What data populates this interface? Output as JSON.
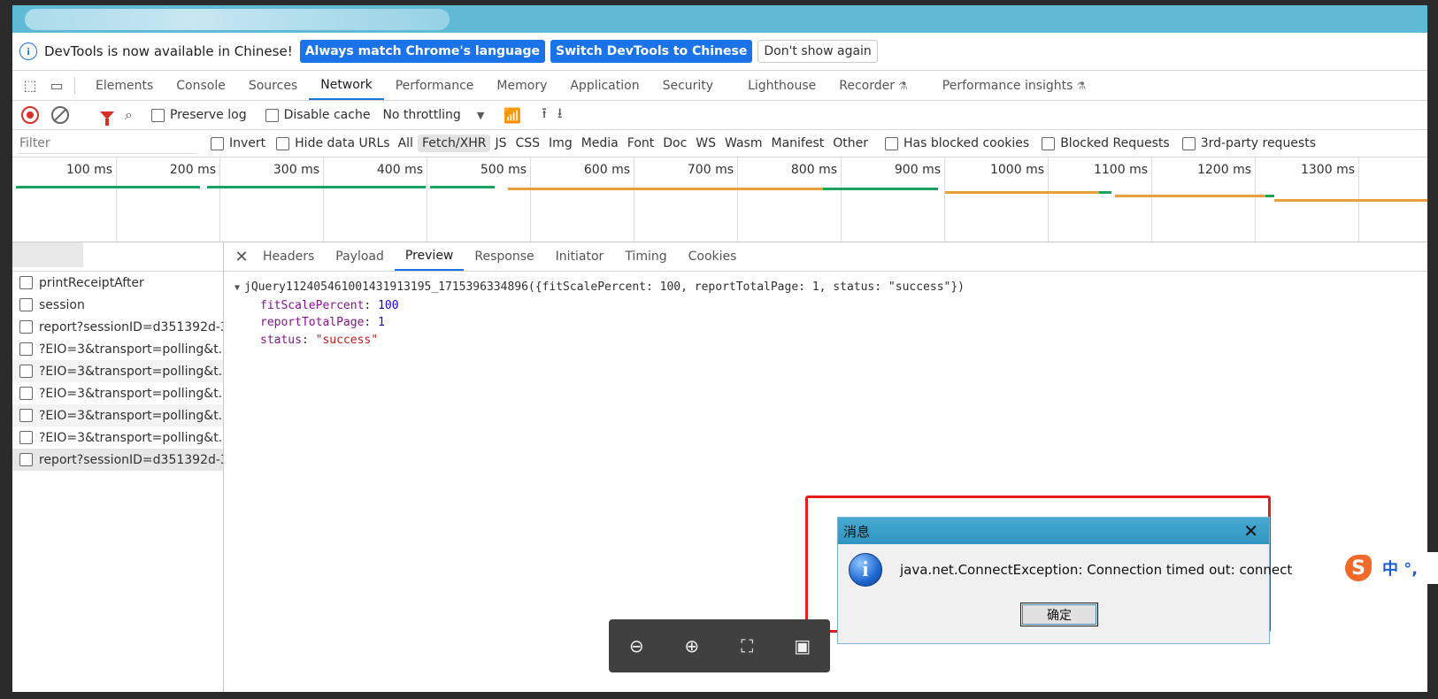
{
  "infobar": {
    "message": "DevTools is now available in Chinese!",
    "btn_match": "Always match Chrome's language",
    "btn_switch": "Switch DevTools to Chinese",
    "btn_dismiss": "Don't show again"
  },
  "tabs": [
    {
      "label": "Elements"
    },
    {
      "label": "Console"
    },
    {
      "label": "Sources"
    },
    {
      "label": "Network",
      "active": true
    },
    {
      "label": "Performance"
    },
    {
      "label": "Memory"
    },
    {
      "label": "Application"
    },
    {
      "label": "Security"
    },
    {
      "label": "Lighthouse"
    },
    {
      "label": "Recorder",
      "flask": true
    },
    {
      "label": "Performance insights",
      "flask": true
    }
  ],
  "toolbar": {
    "preserve_log": "Preserve log",
    "disable_cache": "Disable cache",
    "throttling": "No throttling"
  },
  "filterbar": {
    "placeholder": "Filter",
    "invert": "Invert",
    "hide_data_urls": "Hide data URLs",
    "types": [
      "All",
      "Fetch/XHR",
      "JS",
      "CSS",
      "Img",
      "Media",
      "Font",
      "Doc",
      "WS",
      "Wasm",
      "Manifest",
      "Other"
    ],
    "selected_type": "Fetch/XHR",
    "has_blocked_cookies": "Has blocked cookies",
    "blocked_requests": "Blocked Requests",
    "third_party": "3rd-party requests"
  },
  "timeline": {
    "ticks": [
      "100 ms",
      "200 ms",
      "300 ms",
      "400 ms",
      "500 ms",
      "600 ms",
      "700 ms",
      "800 ms",
      "900 ms",
      "1000 ms",
      "1100 ms",
      "1200 ms",
      "1300 ms"
    ]
  },
  "requests": [
    {
      "name": "printReceiptAfter"
    },
    {
      "name": "session"
    },
    {
      "name": "report?sessionID=d351392d-3..."
    },
    {
      "name": "?EIO=3&transport=polling&t..."
    },
    {
      "name": "?EIO=3&transport=polling&t..."
    },
    {
      "name": "?EIO=3&transport=polling&t..."
    },
    {
      "name": "?EIO=3&transport=polling&t..."
    },
    {
      "name": "?EIO=3&transport=polling&t..."
    },
    {
      "name": "report?sessionID=d351392d-3...",
      "selected": true
    }
  ],
  "detail_tabs": [
    {
      "label": "Headers"
    },
    {
      "label": "Payload"
    },
    {
      "label": "Preview",
      "active": true
    },
    {
      "label": "Response"
    },
    {
      "label": "Initiator"
    },
    {
      "label": "Timing"
    },
    {
      "label": "Cookies"
    }
  ],
  "preview": {
    "summary": "jQuery112405461001431913195_1715396334896({fitScalePercent: 100, reportTotalPage: 1, status: \"success\"})",
    "props": [
      {
        "key": "fitScalePercent",
        "value": "100",
        "kind": "num"
      },
      {
        "key": "reportTotalPage",
        "value": "1",
        "kind": "num"
      },
      {
        "key": "status",
        "value": "\"success\"",
        "kind": "str"
      }
    ]
  },
  "dialog": {
    "title": "消息",
    "message": "java.net.ConnectException: Connection timed out: connect",
    "ok": "确定"
  },
  "ime": {
    "text": "中 °,"
  },
  "colors": {
    "accent": "#1a73e8",
    "highlight": "#e31c1c",
    "dialog_title": "#3aa0c8"
  }
}
